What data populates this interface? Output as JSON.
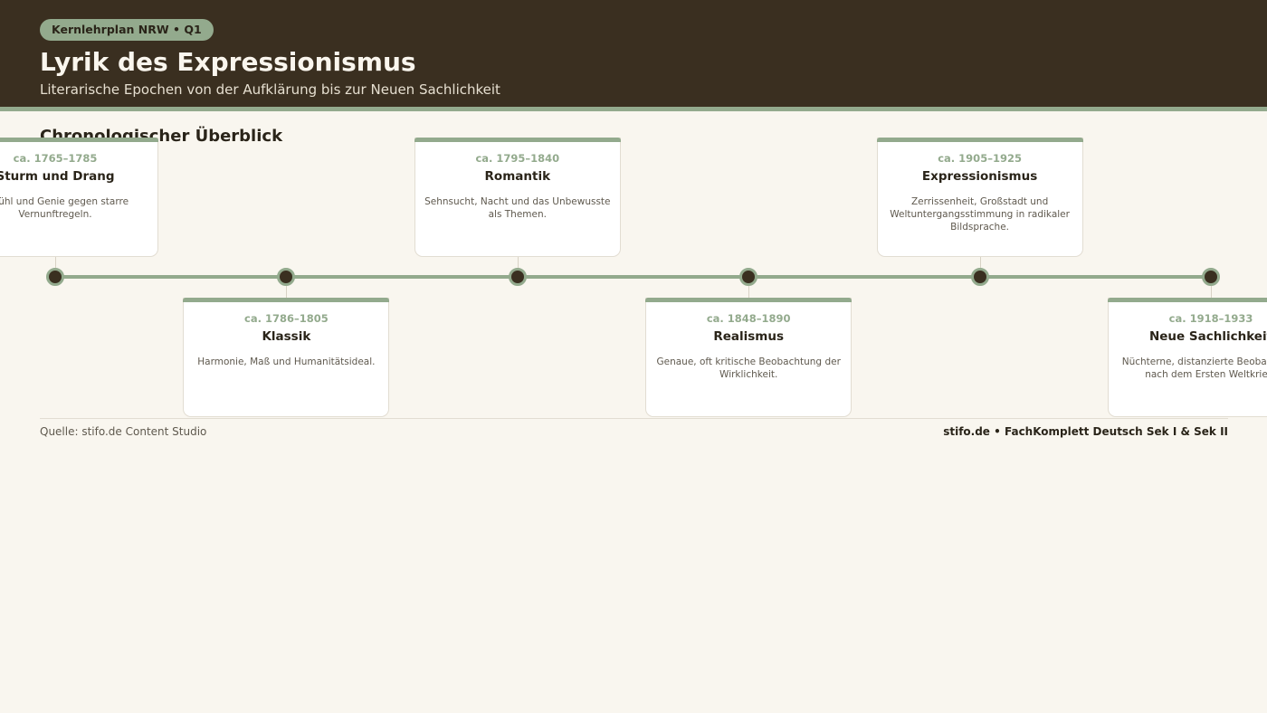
{
  "header": {
    "badge": "Kernlehrplan NRW • Q1",
    "title": "Lyrik des Expressionismus",
    "subtitle": "Literarische Epochen von der Aufklärung bis zur Neuen Sachlichkeit"
  },
  "section_title": "Chronologischer Überblick",
  "epochs": [
    {
      "date": "ca. 1765–1785",
      "name": "Sturm und Drang",
      "desc": "Gefühl und Genie gegen starre Vernunftregeln."
    },
    {
      "date": "ca. 1786–1805",
      "name": "Klassik",
      "desc": "Harmonie, Maß und Humanitätsideal."
    },
    {
      "date": "ca. 1795–1840",
      "name": "Romantik",
      "desc": "Sehnsucht, Nacht und das Unbewusste als Themen."
    },
    {
      "date": "ca. 1848–1890",
      "name": "Realismus",
      "desc": "Genaue, oft kritische Beobachtung der Wirklichkeit."
    },
    {
      "date": "ca. 1905–1925",
      "name": "Expressionismus",
      "desc": "Zerrissenheit, Großstadt und Weltuntergangsstimmung in radikaler Bildsprache."
    },
    {
      "date": "ca. 1918–1933",
      "name": "Neue Sachlichkeit",
      "desc": "Nüchterne, distanzierte Beobachtung nach dem Ersten Weltkrieg."
    }
  ],
  "footer": {
    "source": "Quelle: stifo.de Content Studio",
    "brand": "stifo.de • FachKomplett Deutsch Sek I & Sek II"
  },
  "colors": {
    "header_bg": "#3a2f20",
    "accent": "#93aa8d",
    "page_bg": "#f9f6ef"
  }
}
